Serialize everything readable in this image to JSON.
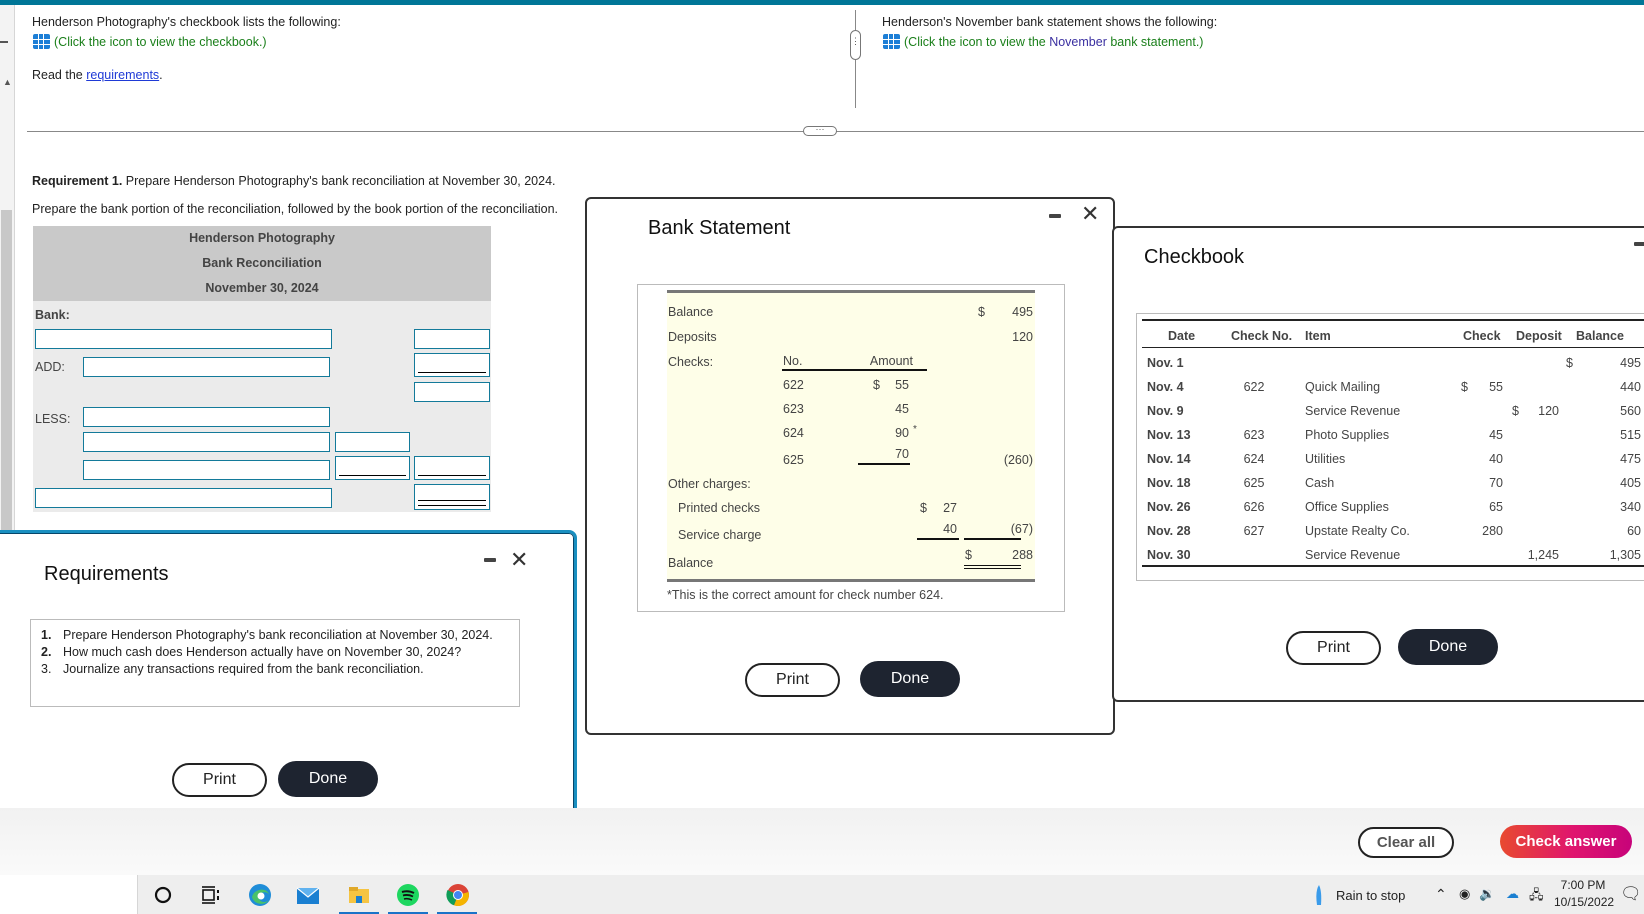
{
  "intro": {
    "checkbook_line": "Henderson Photography's checkbook lists the following:",
    "checkbook_link": "(Click the icon to view the checkbook.)",
    "read_prefix": "Read the ",
    "requirements_link": "requirements",
    "read_suffix": ".",
    "statement_line": "Henderson's November bank statement shows the following:",
    "statement_link_a": "(Click the icon to view the ",
    "statement_link_b": "November",
    "statement_link_c": " bank statement.)"
  },
  "question": {
    "req_label": "Requirement 1.",
    "req_text": " Prepare Henderson Photography's bank reconciliation at November 30, 2024.",
    "instruction": "Prepare the bank portion of the reconciliation, followed by the book portion of the reconciliation."
  },
  "reconciliation": {
    "company": "Henderson Photography",
    "title": "Bank Reconciliation",
    "date": "November 30, 2024",
    "bank_label": "Bank:",
    "add_label": "ADD:",
    "less_label": "LESS:"
  },
  "requirements_modal": {
    "title": "Requirements",
    "items": [
      {
        "num": "1.",
        "text": "Prepare Henderson Photography's bank reconciliation at November 30, 2024."
      },
      {
        "num": "2.",
        "text": "How much cash does Henderson actually have on November 30, 2024?"
      },
      {
        "num": "3.",
        "text": "Journalize any transactions required from the bank reconciliation."
      }
    ],
    "print_label": "Print",
    "done_label": "Done"
  },
  "bank_statement": {
    "title": "Bank Statement",
    "balance_label": "Balance",
    "balance_dollar": "$",
    "balance_value": "495",
    "deposits_label": "Deposits",
    "deposits_value": "120",
    "checks_label": "Checks:",
    "col_no": "No.",
    "col_amount": "Amount",
    "checks": [
      {
        "no": "622",
        "dollar": "$",
        "amount": "55",
        "mark": ""
      },
      {
        "no": "623",
        "dollar": "",
        "amount": "45",
        "mark": ""
      },
      {
        "no": "624",
        "dollar": "",
        "amount": "90",
        "mark": "*"
      },
      {
        "no": "625",
        "dollar": "",
        "amount": "70",
        "mark": ""
      }
    ],
    "checks_total": "(260)",
    "other_charges_label": "Other charges:",
    "printed_checks_label": "Printed checks",
    "printed_checks_dollar": "$",
    "printed_checks_value": "27",
    "service_charge_label": "Service charge",
    "service_charge_value": "40",
    "other_total": "(67)",
    "ending_label": "Balance",
    "ending_dollar": "$",
    "ending_value": "288",
    "footnote": "*This is the correct amount for check number 624.",
    "print_label": "Print",
    "done_label": "Done"
  },
  "checkbook": {
    "title": "Checkbook",
    "headers": {
      "date": "Date",
      "check_no": "Check No.",
      "item": "Item",
      "check": "Check",
      "deposit": "Deposit",
      "balance": "Balance"
    },
    "rows": [
      {
        "date": "Nov. 1",
        "check_no": "",
        "item": "",
        "check_dollar": "",
        "check": "",
        "deposit_dollar": "",
        "deposit": "",
        "balance_dollar": "$",
        "balance": "495"
      },
      {
        "date": "Nov. 4",
        "check_no": "622",
        "item": "Quick Mailing",
        "check_dollar": "$",
        "check": "55",
        "deposit_dollar": "",
        "deposit": "",
        "balance_dollar": "",
        "balance": "440"
      },
      {
        "date": "Nov. 9",
        "check_no": "",
        "item": "Service Revenue",
        "check_dollar": "",
        "check": "",
        "deposit_dollar": "$",
        "deposit": "120",
        "balance_dollar": "",
        "balance": "560"
      },
      {
        "date": "Nov. 13",
        "check_no": "623",
        "item": "Photo Supplies",
        "check_dollar": "",
        "check": "45",
        "deposit_dollar": "",
        "deposit": "",
        "balance_dollar": "",
        "balance": "515"
      },
      {
        "date": "Nov. 14",
        "check_no": "624",
        "item": "Utilities",
        "check_dollar": "",
        "check": "40",
        "deposit_dollar": "",
        "deposit": "",
        "balance_dollar": "",
        "balance": "475"
      },
      {
        "date": "Nov. 18",
        "check_no": "625",
        "item": "Cash",
        "check_dollar": "",
        "check": "70",
        "deposit_dollar": "",
        "deposit": "",
        "balance_dollar": "",
        "balance": "405"
      },
      {
        "date": "Nov. 26",
        "check_no": "626",
        "item": "Office Supplies",
        "check_dollar": "",
        "check": "65",
        "deposit_dollar": "",
        "deposit": "",
        "balance_dollar": "",
        "balance": "340"
      },
      {
        "date": "Nov. 28",
        "check_no": "627",
        "item": "Upstate Realty Co.",
        "check_dollar": "",
        "check": "280",
        "deposit_dollar": "",
        "deposit": "",
        "balance_dollar": "",
        "balance": "60"
      },
      {
        "date": "Nov. 30",
        "check_no": "",
        "item": "Service Revenue",
        "check_dollar": "",
        "check": "",
        "deposit_dollar": "",
        "deposit": "1,245",
        "balance_dollar": "",
        "balance": "1,305"
      }
    ],
    "print_label": "Print",
    "done_label": "Done"
  },
  "actions": {
    "clear_all": "Clear all",
    "check_answer": "Check answer"
  },
  "taskbar": {
    "weather": "Rain to stop",
    "time": "7:00 PM",
    "date": "10/15/2022"
  }
}
